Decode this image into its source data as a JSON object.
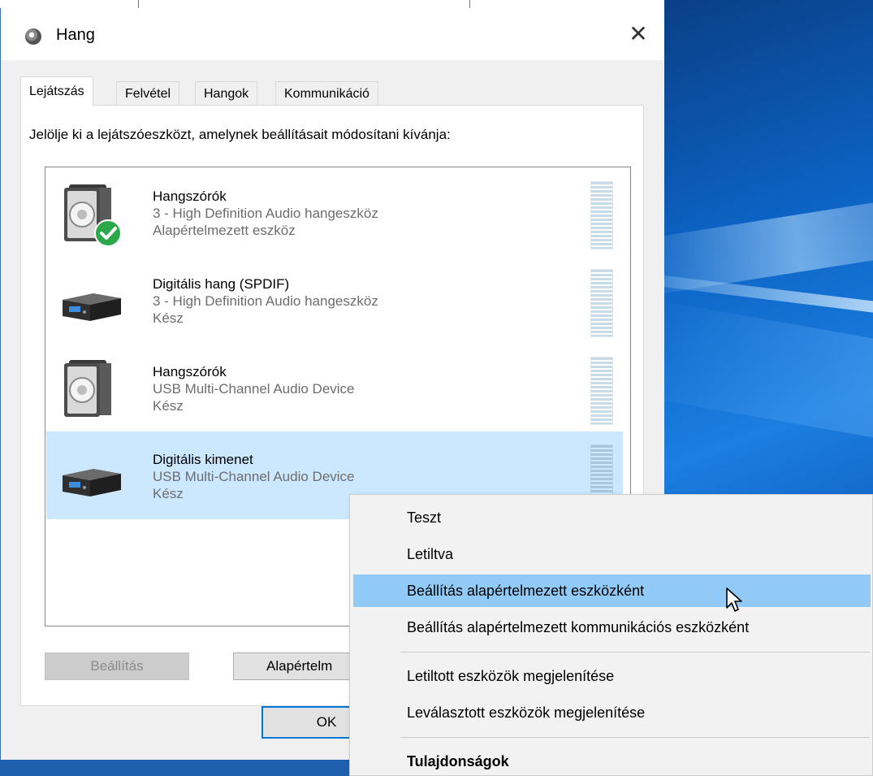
{
  "window": {
    "title": "Hang",
    "close_glyph": "✕"
  },
  "tabs": [
    {
      "label": "Lejátszás",
      "active": true
    },
    {
      "label": "Felvétel",
      "active": false
    },
    {
      "label": "Hangok",
      "active": false
    },
    {
      "label": "Kommunikáció",
      "active": false
    }
  ],
  "instruction": "Jelölje ki a lejátszóeszközt, amelynek beállításait módosítani kívánja:",
  "devices": [
    {
      "name": "Hangszórók",
      "driver": "3 - High Definition Audio hangeszköz",
      "status": "Alapértelmezett eszköz",
      "icon": "speaker-icon",
      "default": true,
      "selected": false
    },
    {
      "name": "Digitális hang (SPDIF)",
      "driver": "3 - High Definition Audio hangeszköz",
      "status": "Kész",
      "icon": "digital-receiver-icon",
      "default": false,
      "selected": false
    },
    {
      "name": "Hangszórók",
      "driver": "USB Multi-Channel Audio Device",
      "status": "Kész",
      "icon": "speaker-icon",
      "default": false,
      "selected": false
    },
    {
      "name": "Digitális kimenet",
      "driver": "USB Multi-Channel Audio Device",
      "status": "Kész",
      "icon": "digital-receiver-icon",
      "default": false,
      "selected": true
    }
  ],
  "buttons": {
    "configure": "Beállítás",
    "set_default": "Alapértelm",
    "ok": "OK"
  },
  "context_menu": {
    "items": [
      {
        "label": "Teszt",
        "hover": false,
        "bold": false
      },
      {
        "label": "Letiltva",
        "hover": false,
        "bold": false
      },
      {
        "label": "Beállítás alapértelmezett eszközként",
        "hover": true,
        "bold": false
      },
      {
        "label": "Beállítás alapértelmezett kommunikációs eszközként",
        "hover": false,
        "bold": false
      },
      {
        "label": "Letiltott eszközök megjelenítése",
        "hover": false,
        "bold": false
      },
      {
        "label": "Leválasztott eszközök megjelenítése",
        "hover": false,
        "bold": false
      },
      {
        "label": "Tulajdonságok",
        "hover": false,
        "bold": true
      }
    ]
  },
  "colors": {
    "selection": "#cce8ff",
    "menu_hover": "#91c9f7",
    "default_check": "#2ba84a",
    "accent": "#0078d7"
  }
}
